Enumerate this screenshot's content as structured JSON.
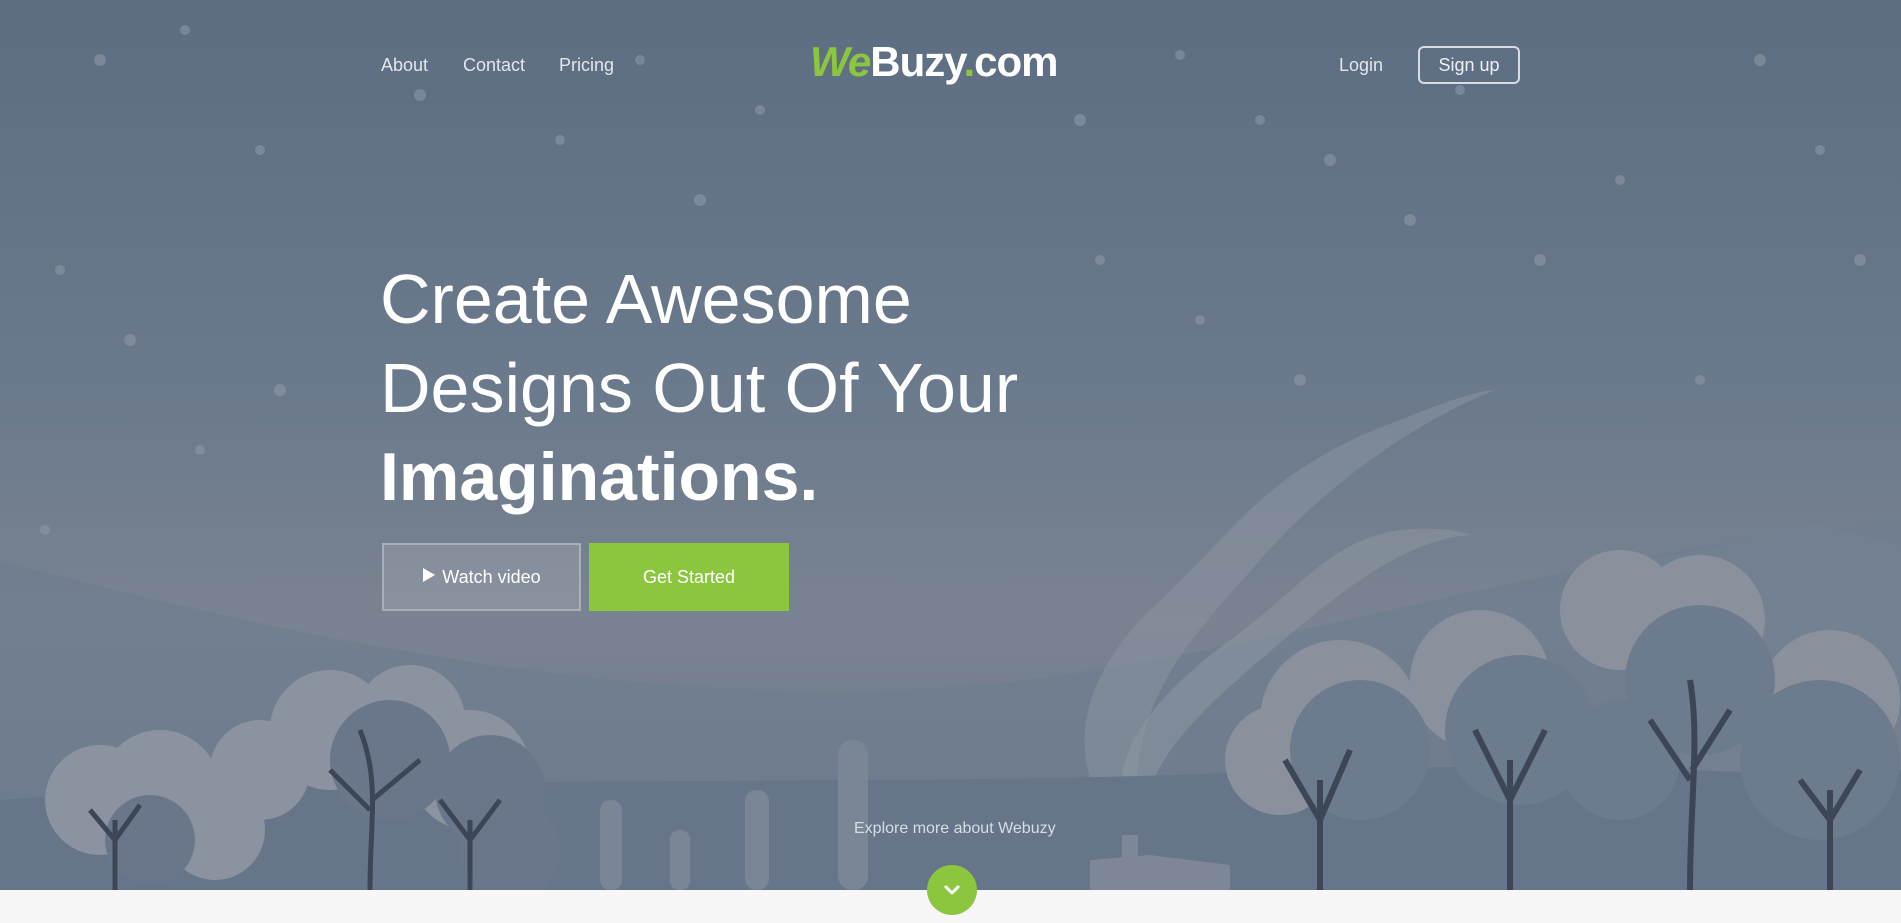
{
  "nav": {
    "links": [
      "About",
      "Contact",
      "Pricing"
    ],
    "logo": {
      "part1": "We",
      "part2": "Buzy",
      "dot": ".",
      "part3": "com"
    },
    "login": "Login",
    "signup": "Sign up"
  },
  "hero": {
    "line1": "Create Awesome",
    "line2": "Designs Out Of Your",
    "line3": "Imaginations.",
    "watch_label": "Watch video",
    "start_label": "Get Started",
    "explore": "Explore more about Webuzy"
  },
  "icons": {
    "play": "play-icon",
    "scroll": "chevron-down-icon"
  },
  "colors": {
    "accent": "#8cc63f",
    "hero_bg": "#6b7a8c",
    "text_light": "#ffffff"
  }
}
